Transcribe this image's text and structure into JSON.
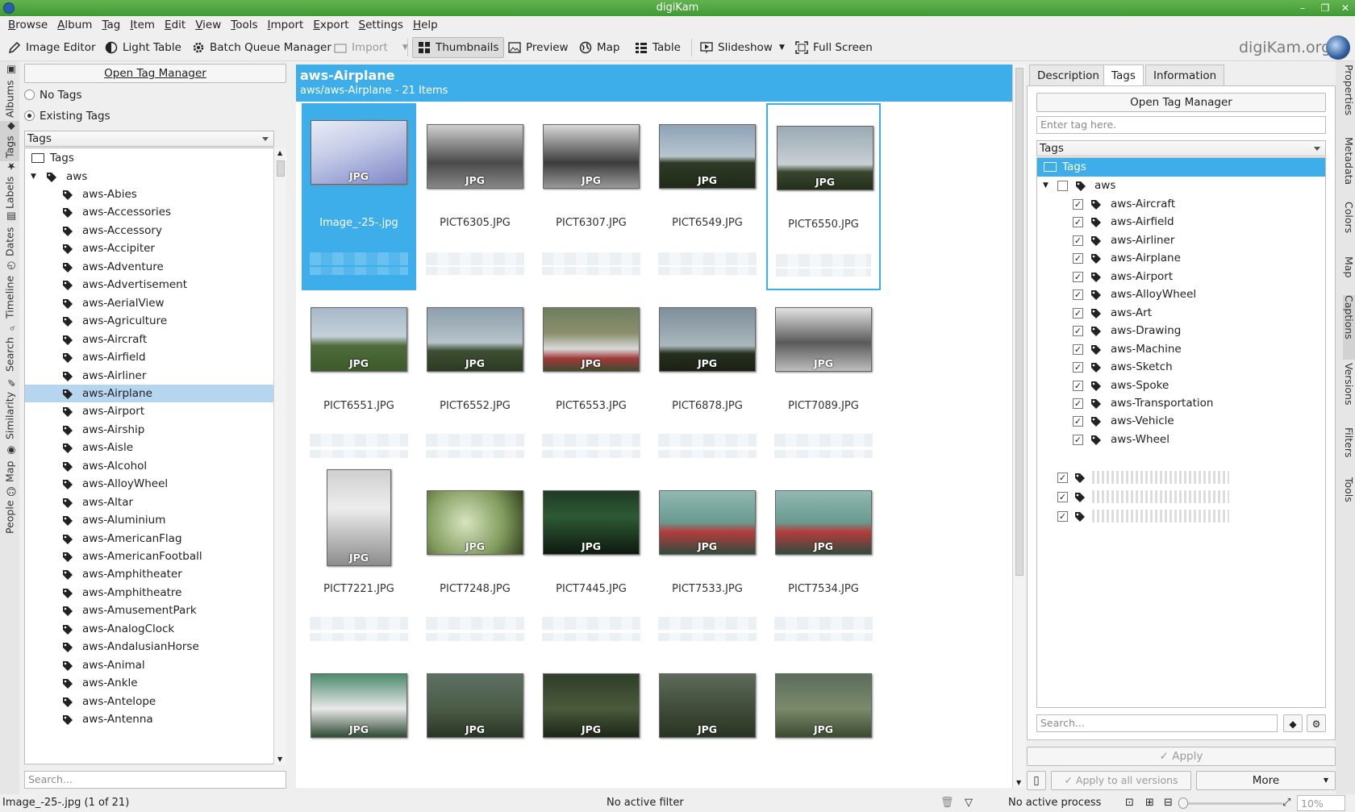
{
  "window": {
    "title": "digiKam"
  },
  "menu": [
    "Browse",
    "Album",
    "Tag",
    "Item",
    "Edit",
    "View",
    "Tools",
    "Import",
    "Export",
    "Settings",
    "Help"
  ],
  "toolbar": {
    "image_editor": "Image Editor",
    "light_table": "Light Table",
    "batch_queue": "Batch Queue Manager",
    "import": "Import",
    "thumbnails": "Thumbnails",
    "preview": "Preview",
    "map": "Map",
    "table": "Table",
    "slideshow": "Slideshow",
    "fullscreen": "Full Screen",
    "brand": "digiKam.org"
  },
  "left_tabs": [
    "Albums",
    "Tags",
    "Labels",
    "Dates",
    "Timeline",
    "Search",
    "Similarity",
    "Map",
    "People"
  ],
  "left_panel": {
    "open_tag_manager": "Open Tag Manager",
    "no_tags": "No Tags",
    "existing_tags": "Existing Tags",
    "combo": "Tags",
    "root": "Tags",
    "group": "aws",
    "tags": [
      "aws-Abies",
      "aws-Accessories",
      "aws-Accessory",
      "aws-Accipiter",
      "aws-Adventure",
      "aws-Advertisement",
      "aws-AerialView",
      "aws-Agriculture",
      "aws-Aircraft",
      "aws-Airfield",
      "aws-Airliner",
      "aws-Airplane",
      "aws-Airport",
      "aws-Airship",
      "aws-Aisle",
      "aws-Alcohol",
      "aws-AlloyWheel",
      "aws-Altar",
      "aws-Aluminium",
      "aws-AmericanFlag",
      "aws-AmericanFootball",
      "aws-Amphitheater",
      "aws-Amphitheatre",
      "aws-AmusementPark",
      "aws-AnalogClock",
      "aws-AndalusianHorse",
      "aws-Animal",
      "aws-Ankle",
      "aws-Antelope",
      "aws-Antenna"
    ],
    "selected_tag": "aws-Airplane",
    "search_placeholder": "Search..."
  },
  "main": {
    "title": "aws-Airplane",
    "subtitle": "aws/aws-Airplane - 21 Items",
    "badge": "JPG",
    "items": [
      "Image_-25-.jpg",
      "PICT6305.JPG",
      "PICT6307.JPG",
      "PICT6549.JPG",
      "PICT6550.JPG",
      "PICT6551.JPG",
      "PICT6552.JPG",
      "PICT6553.JPG",
      "PICT6878.JPG",
      "PICT7089.JPG",
      "PICT7221.JPG",
      "PICT7248.JPG",
      "PICT7445.JPG",
      "PICT7533.JPG",
      "PICT7534.JPG",
      "",
      "",
      "",
      "",
      ""
    ]
  },
  "right_panel": {
    "tabs": [
      "Description",
      "Tags",
      "Information"
    ],
    "open_tag_manager": "Open Tag Manager",
    "tag_input_placeholder": "Enter tag here.",
    "combo": "Tags",
    "root": "Tags",
    "group": "aws",
    "assigned": [
      "aws-Aircraft",
      "aws-Airfield",
      "aws-Airliner",
      "aws-Airplane",
      "aws-Airport",
      "aws-AlloyWheel",
      "aws-Art",
      "aws-Drawing",
      "aws-Machine",
      "aws-Sketch",
      "aws-Spoke",
      "aws-Transportation",
      "aws-Vehicle",
      "aws-Wheel"
    ],
    "search_placeholder": "Search...",
    "apply": "Apply",
    "apply_all": "Apply to all versions",
    "more": "More"
  },
  "right_tabs": [
    "Properties",
    "Metadata",
    "Colors",
    "Map",
    "Captions",
    "Versions",
    "Filters",
    "Tools"
  ],
  "status": {
    "left": "Image_-25-.jpg (1 of 21)",
    "filter": "No active filter",
    "process": "No active process",
    "zoom": "10%"
  },
  "colors": {
    "accent": "#3daee9",
    "titlebar": "#4fa73f",
    "selection": "#b6d6f0"
  }
}
